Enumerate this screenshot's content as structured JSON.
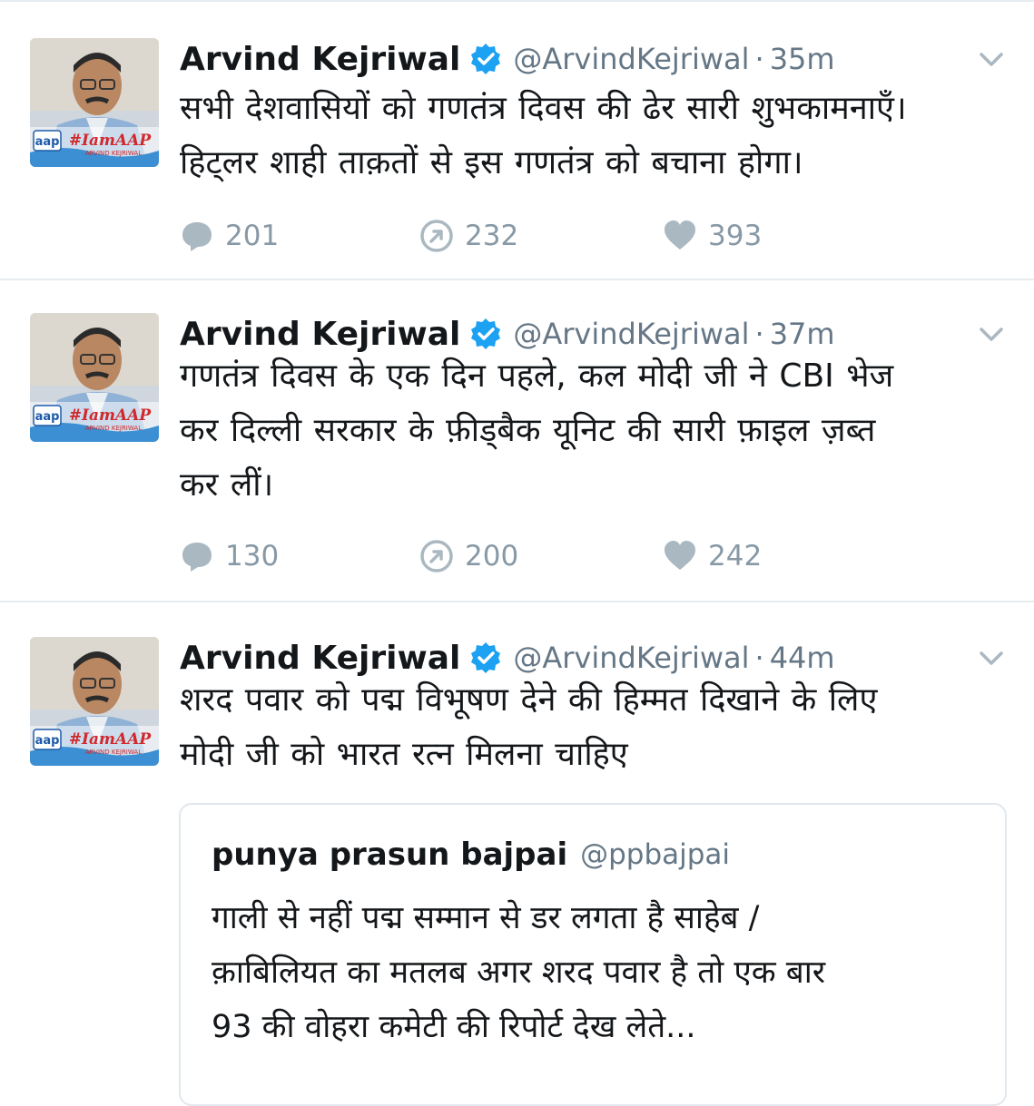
{
  "tweets": [
    {
      "author": "Arvind Kejriwal",
      "handle": "@ArvindKejriwal",
      "separator": "·",
      "time": "35m",
      "lines": [
        "सभी देशवासियों को गणतंत्र दिवस की ढेर सारी शुभकामनाएँ।",
        "हिट्लर शाही ताक़तों से इस गणतंत्र को बचाना होगा।"
      ],
      "replies": "201",
      "retweets": "232",
      "likes": "393"
    },
    {
      "author": "Arvind Kejriwal",
      "handle": "@ArvindKejriwal",
      "separator": "·",
      "time": "37m",
      "lines": [
        "गणतंत्र दिवस के एक दिन पहले, कल मोदी जी ने CBI भेज",
        "कर दिल्ली सरकार के फ़ीड्बैक यूनिट की सारी फ़ाइल  ज़ब्त",
        "कर लीं।"
      ],
      "replies": "130",
      "retweets": "200",
      "likes": "242"
    },
    {
      "author": "Arvind Kejriwal",
      "handle": "@ArvindKejriwal",
      "separator": "·",
      "time": "44m",
      "lines": [
        "शरद पवार को पद्म विभूषण देने की हिम्मत दिखाने के लिए",
        "मोदी जी को भारत रत्न मिलना चाहिए"
      ]
    }
  ],
  "quoted": {
    "author": "punya prasun bajpai",
    "handle": "@ppbajpai",
    "lines": [
      "गाली से नहीं पद्म सम्मान से डर लगता है साहेब /",
      "क़ाबिलियत का मतलब अगर शरद पवार है तो एक बार",
      "93 की वोहरा कमेटी की रिपोर्ट देख लेते..."
    ]
  },
  "avatar_text": {
    "party": "aap",
    "hashtag": "#IamAAP",
    "caption": "ARVIND KEJRIWAL"
  },
  "colors": {
    "verified": "#1da1f2",
    "icon_gray": "#aab8c2",
    "text_gray": "#657786",
    "divider": "#e6ecf0"
  },
  "icons": [
    "verified-badge-icon",
    "chevron-down-icon",
    "reply-icon",
    "retweet-icon",
    "like-icon"
  ]
}
